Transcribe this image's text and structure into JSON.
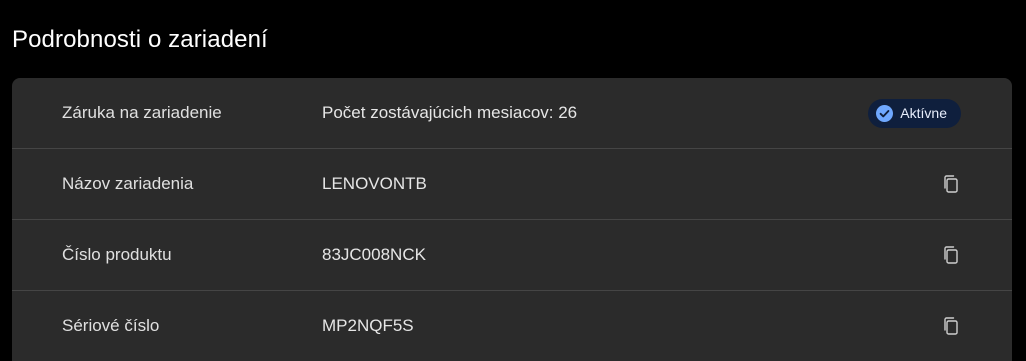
{
  "page": {
    "title": "Podrobnosti o zariadení"
  },
  "details": {
    "rows": [
      {
        "label": "Záruka na zariadenie",
        "value": "Počet zostávajúcich mesiacov: 26",
        "badge": "Aktívne",
        "badge_icon": "check-circle-icon"
      },
      {
        "label": "Názov zariadenia",
        "value": "LENOVONTB",
        "action_icon": "copy-icon"
      },
      {
        "label": "Číslo produktu",
        "value": "83JC008NCK",
        "action_icon": "copy-icon"
      },
      {
        "label": "Sériové číslo",
        "value": "MP2NQF5S",
        "action_icon": "copy-icon"
      }
    ]
  },
  "colors": {
    "background": "#000000",
    "card": "#2b2b2b",
    "divider": "#454545",
    "badge_bg": "#0f1f3d",
    "accent": "#6fa8ff"
  }
}
